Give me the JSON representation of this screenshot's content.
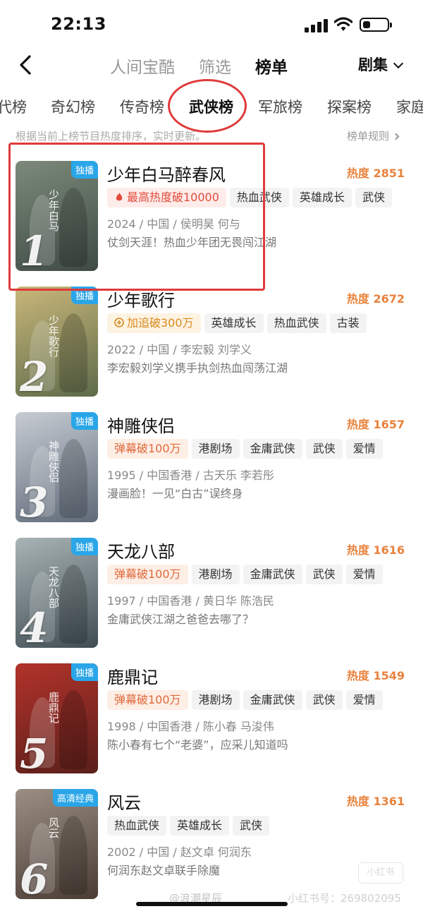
{
  "status": {
    "time": "22:13",
    "battery_level": 0.3
  },
  "nav": {
    "tabs": [
      "人间宝酷",
      "筛选",
      "榜单"
    ],
    "active_tab": "榜单",
    "genre": "剧集"
  },
  "categories": [
    "代榜",
    "奇幻榜",
    "传奇榜",
    "武侠榜",
    "军旅榜",
    "探案榜",
    "家庭"
  ],
  "active_category": "武侠榜",
  "hint": "根据当前上榜节目热度排序，实时更新。",
  "rules_link": "榜单规则",
  "items": [
    {
      "rank": "1",
      "badge": "独播",
      "title": "少年白马醉春风",
      "heat": "热度 2851",
      "tags": [
        {
          "text": "最高热度破10000",
          "style": "hot"
        },
        {
          "text": "热血武侠",
          "style": ""
        },
        {
          "text": "英雄成长",
          "style": ""
        },
        {
          "text": "武侠",
          "style": ""
        }
      ],
      "meta": "2024 / 中国 / 侯明昊  何与",
      "desc": "仗剑天涯！热血少年团无畏闯江湖",
      "poster_text": "少年白马",
      "colors": {
        "bg1": "#7c8a7a",
        "bg2": "#3e4a44"
      }
    },
    {
      "rank": "2",
      "badge": "独播",
      "title": "少年歌行",
      "heat": "热度 2672",
      "tags": [
        {
          "text": "加追破300万",
          "style": "gold"
        },
        {
          "text": "英雄成长",
          "style": ""
        },
        {
          "text": "热血武侠",
          "style": ""
        },
        {
          "text": "古装",
          "style": ""
        }
      ],
      "meta": "2022 / 中国 / 李宏毅  刘学义",
      "desc": "李宏毅刘学义携手执剑热血闯荡江湖",
      "poster_text": "少年歌行",
      "colors": {
        "bg1": "#c9b77a",
        "bg2": "#5e6b4a"
      }
    },
    {
      "rank": "3",
      "badge": "独播",
      "title": "神雕侠侣",
      "heat": "热度 1657",
      "tags": [
        {
          "text": "弹幕破100万",
          "style": "danmu"
        },
        {
          "text": "港剧场",
          "style": ""
        },
        {
          "text": "金庸武侠",
          "style": ""
        },
        {
          "text": "武侠",
          "style": ""
        },
        {
          "text": "爱情",
          "style": ""
        }
      ],
      "meta": "1995 / 中国香港 / 古天乐  李若彤",
      "desc": "漫画脸！一见“白古”误终身",
      "poster_text": "神雕侠侣",
      "colors": {
        "bg1": "#c7ccd3",
        "bg2": "#5f6a78"
      }
    },
    {
      "rank": "4",
      "badge": "独播",
      "title": "天龙八部",
      "heat": "热度 1616",
      "tags": [
        {
          "text": "弹幕破100万",
          "style": "danmu"
        },
        {
          "text": "港剧场",
          "style": ""
        },
        {
          "text": "金庸武侠",
          "style": ""
        },
        {
          "text": "武侠",
          "style": ""
        },
        {
          "text": "爱情",
          "style": ""
        }
      ],
      "meta": "1997 / 中国香港 / 黄日华  陈浩民",
      "desc": "金庸武侠江湖之爸爸去哪了？",
      "poster_text": "天龙八部",
      "colors": {
        "bg1": "#a9b4b6",
        "bg2": "#3f4c52"
      }
    },
    {
      "rank": "5",
      "badge": "独播",
      "title": "鹿鼎记",
      "heat": "热度 1549",
      "tags": [
        {
          "text": "弹幕破100万",
          "style": "danmu"
        },
        {
          "text": "港剧场",
          "style": ""
        },
        {
          "text": "金庸武侠",
          "style": ""
        },
        {
          "text": "武侠",
          "style": ""
        },
        {
          "text": "爱情",
          "style": ""
        }
      ],
      "meta": "1998 / 中国香港 / 陈小春  马浚伟",
      "desc": "陈小春有七个“老婆”，应采儿知道吗",
      "poster_text": "鹿鼎记",
      "colors": {
        "bg1": "#b2332b",
        "bg2": "#5a1f1a"
      }
    },
    {
      "rank": "6",
      "badge": "高清经典",
      "title": "风云",
      "heat": "热度 1361",
      "tags": [
        {
          "text": "热血武侠",
          "style": ""
        },
        {
          "text": "英雄成长",
          "style": ""
        },
        {
          "text": "武侠",
          "style": ""
        }
      ],
      "meta": "2002 / 中国 / 赵文卓  何润东",
      "desc": "何润东赵文卓联手除魔",
      "poster_text": "风云",
      "colors": {
        "bg1": "#9b8f85",
        "bg2": "#4a3c34"
      }
    }
  ],
  "watermarks": {
    "left": "@浪潮星辰",
    "right": "小红书号：269802095",
    "stamp": "小红书"
  }
}
